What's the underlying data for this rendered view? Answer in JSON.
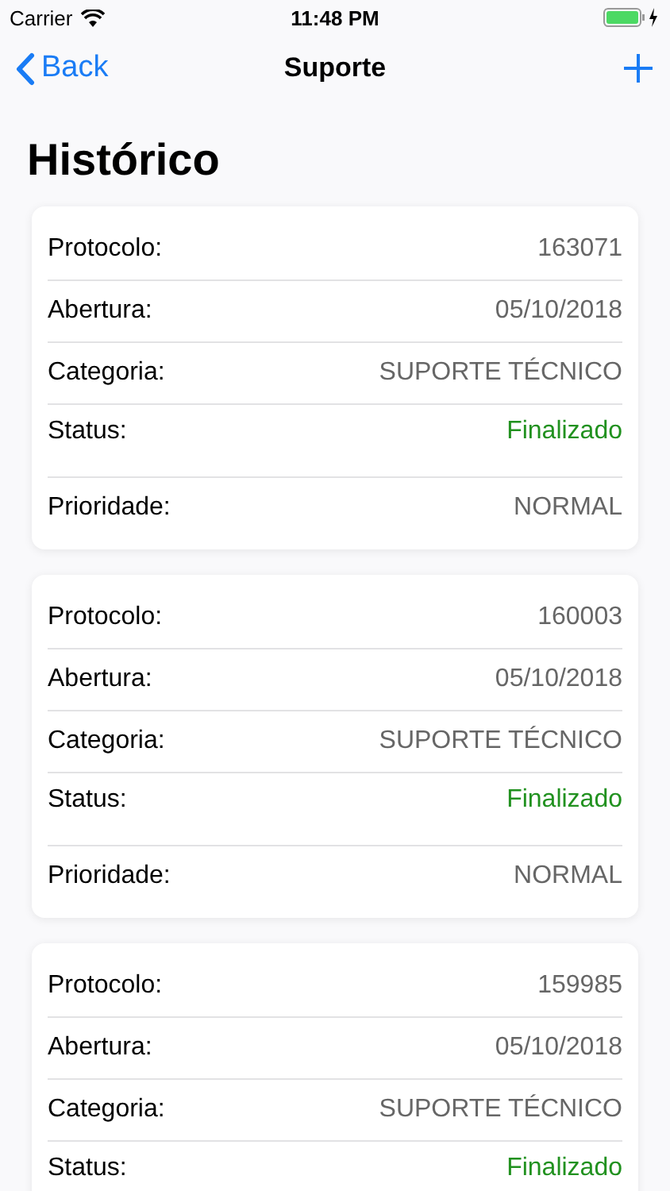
{
  "status_bar": {
    "carrier": "Carrier",
    "time": "11:48 PM"
  },
  "nav_bar": {
    "back": "Back",
    "title": "Suporte"
  },
  "heading": "Histórico",
  "tickets": [
    {
      "fields": [
        {
          "label": "Protocolo:",
          "value": "163071",
          "kind": "plain"
        },
        {
          "label": "Abertura:",
          "value": "05/10/2018",
          "kind": "plain"
        },
        {
          "label": "Categoria:",
          "value": "SUPORTE TÉCNICO",
          "kind": "plain"
        },
        {
          "label": "Status:",
          "value": "Finalizado",
          "kind": "status"
        },
        {
          "label": "Prioridade:",
          "value": "NORMAL",
          "kind": "plain"
        }
      ]
    },
    {
      "fields": [
        {
          "label": "Protocolo:",
          "value": "160003",
          "kind": "plain"
        },
        {
          "label": "Abertura:",
          "value": "05/10/2018",
          "kind": "plain"
        },
        {
          "label": "Categoria:",
          "value": "SUPORTE TÉCNICO",
          "kind": "plain"
        },
        {
          "label": "Status:",
          "value": "Finalizado",
          "kind": "status"
        },
        {
          "label": "Prioridade:",
          "value": "NORMAL",
          "kind": "plain"
        }
      ]
    },
    {
      "fields": [
        {
          "label": "Protocolo:",
          "value": "159985",
          "kind": "plain"
        },
        {
          "label": "Abertura:",
          "value": "05/10/2018",
          "kind": "plain"
        },
        {
          "label": "Categoria:",
          "value": "SUPORTE TÉCNICO",
          "kind": "plain"
        },
        {
          "label": "Status:",
          "value": "Finalizado",
          "kind": "status"
        }
      ]
    }
  ]
}
